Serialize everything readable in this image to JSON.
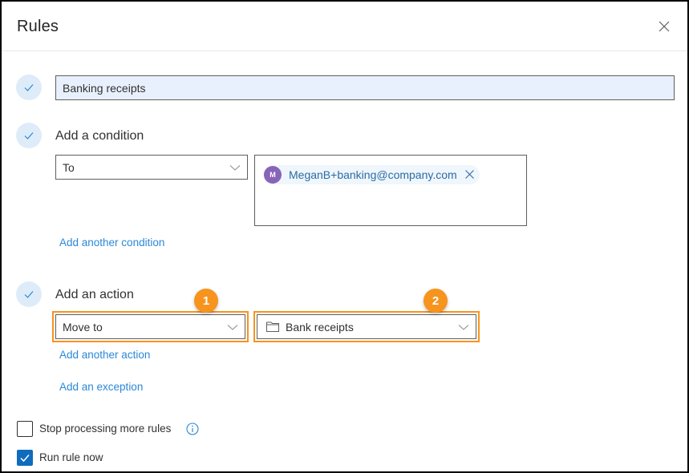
{
  "dialog": {
    "title": "Rules",
    "close_icon": "close-icon"
  },
  "rule_name": {
    "value": "Banking receipts",
    "step_icon": "checkmark-icon"
  },
  "condition": {
    "label": "Add a condition",
    "step_icon": "checkmark-icon",
    "select_value": "To",
    "recipients": [
      {
        "initial": "M",
        "email": "MeganB+banking@company.com",
        "avatar_color": "#8764b8"
      }
    ],
    "add_another_label": "Add another condition"
  },
  "action": {
    "label": "Add an action",
    "step_icon": "checkmark-icon",
    "select_value": "Move to",
    "folder_value": "Bank receipts",
    "folder_icon": "folder-icon",
    "add_another_label": "Add another action",
    "add_exception_label": "Add an exception"
  },
  "callouts": [
    {
      "number": "1"
    },
    {
      "number": "2"
    }
  ],
  "options": {
    "stop_processing": {
      "label": "Stop processing more rules",
      "checked": false,
      "info_icon": "info-icon"
    },
    "run_now": {
      "label": "Run rule now",
      "checked": true
    }
  },
  "colors": {
    "accent": "#0f6cbd",
    "link": "#2b88d8",
    "callout": "#f7941d",
    "input_fill": "#e8f0fd",
    "step_circle": "#deecf9"
  }
}
